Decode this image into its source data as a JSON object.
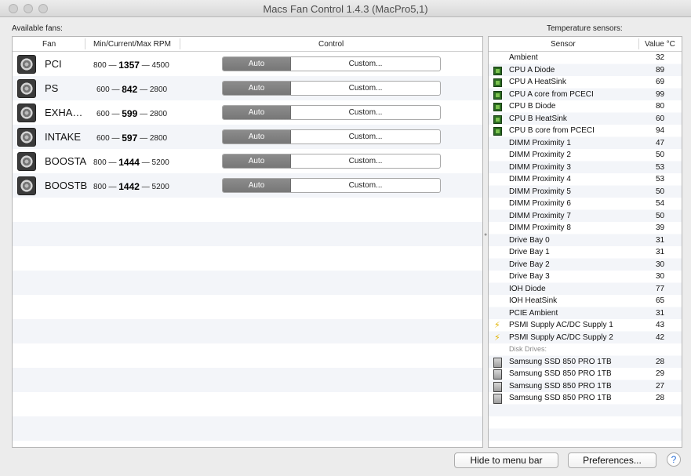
{
  "window": {
    "title": "Macs Fan Control 1.4.3 (MacPro5,1)"
  },
  "fans_section": {
    "label": "Available fans:",
    "headers": {
      "fan": "Fan",
      "rpm": "Min/Current/Max RPM",
      "control": "Control"
    },
    "fans": [
      {
        "name": "PCI",
        "min": "800",
        "current": "1357",
        "max": "4500",
        "auto": "Auto",
        "custom": "Custom..."
      },
      {
        "name": "PS",
        "min": "600",
        "current": "842",
        "max": "2800",
        "auto": "Auto",
        "custom": "Custom..."
      },
      {
        "name": "EXHA…",
        "min": "600",
        "current": "599",
        "max": "2800",
        "auto": "Auto",
        "custom": "Custom..."
      },
      {
        "name": "INTAKE",
        "min": "600",
        "current": "597",
        "max": "2800",
        "auto": "Auto",
        "custom": "Custom..."
      },
      {
        "name": "BOOSTA",
        "min": "800",
        "current": "1444",
        "max": "5200",
        "auto": "Auto",
        "custom": "Custom..."
      },
      {
        "name": "BOOSTB",
        "min": "800",
        "current": "1442",
        "max": "5200",
        "auto": "Auto",
        "custom": "Custom..."
      }
    ],
    "dash": "—"
  },
  "temp_section": {
    "label": "Temperature sensors:",
    "headers": {
      "sensor": "Sensor",
      "value": "Value °C"
    },
    "sensors": [
      {
        "name": "Ambient",
        "value": "32",
        "icon": "none"
      },
      {
        "name": "CPU A Diode",
        "value": "89",
        "icon": "chip-icon"
      },
      {
        "name": "CPU A HeatSink",
        "value": "69",
        "icon": "chip-icon"
      },
      {
        "name": "CPU A core from PCECI",
        "value": "99",
        "icon": "chip-icon"
      },
      {
        "name": "CPU B Diode",
        "value": "80",
        "icon": "chip-icon"
      },
      {
        "name": "CPU B HeatSink",
        "value": "60",
        "icon": "chip-icon"
      },
      {
        "name": "CPU B core from PCECI",
        "value": "94",
        "icon": "chip-icon"
      },
      {
        "name": "DIMM Proximity 1",
        "value": "47",
        "icon": "none"
      },
      {
        "name": "DIMM Proximity 2",
        "value": "50",
        "icon": "none"
      },
      {
        "name": "DIMM Proximity 3",
        "value": "53",
        "icon": "none"
      },
      {
        "name": "DIMM Proximity 4",
        "value": "53",
        "icon": "none"
      },
      {
        "name": "DIMM Proximity 5",
        "value": "50",
        "icon": "none"
      },
      {
        "name": "DIMM Proximity 6",
        "value": "54",
        "icon": "none"
      },
      {
        "name": "DIMM Proximity 7",
        "value": "50",
        "icon": "none"
      },
      {
        "name": "DIMM Proximity 8",
        "value": "39",
        "icon": "none"
      },
      {
        "name": "Drive Bay 0",
        "value": "31",
        "icon": "none"
      },
      {
        "name": "Drive Bay 1",
        "value": "31",
        "icon": "none"
      },
      {
        "name": "Drive Bay 2",
        "value": "30",
        "icon": "none"
      },
      {
        "name": "Drive Bay 3",
        "value": "30",
        "icon": "none"
      },
      {
        "name": "IOH Diode",
        "value": "77",
        "icon": "none"
      },
      {
        "name": "IOH HeatSink",
        "value": "65",
        "icon": "none"
      },
      {
        "name": "PCIE Ambient",
        "value": "31",
        "icon": "none"
      },
      {
        "name": "PSMI Supply AC/DC Supply 1",
        "value": "43",
        "icon": "bolt-icon"
      },
      {
        "name": "PSMI Supply AC/DC Supply 2",
        "value": "42",
        "icon": "bolt-icon"
      }
    ],
    "disk_group_label": "Disk Drives:",
    "disks": [
      {
        "name": "Samsung SSD 850 PRO 1TB",
        "value": "28",
        "icon": "disk-icon"
      },
      {
        "name": "Samsung SSD 850 PRO 1TB",
        "value": "29",
        "icon": "disk-icon"
      },
      {
        "name": "Samsung SSD 850 PRO 1TB",
        "value": "27",
        "icon": "disk-icon"
      },
      {
        "name": "Samsung SSD 850 PRO 1TB",
        "value": "28",
        "icon": "disk-icon"
      }
    ]
  },
  "footer": {
    "hide_button": "Hide to menu bar",
    "preferences_button": "Preferences...",
    "help_button": "?"
  }
}
